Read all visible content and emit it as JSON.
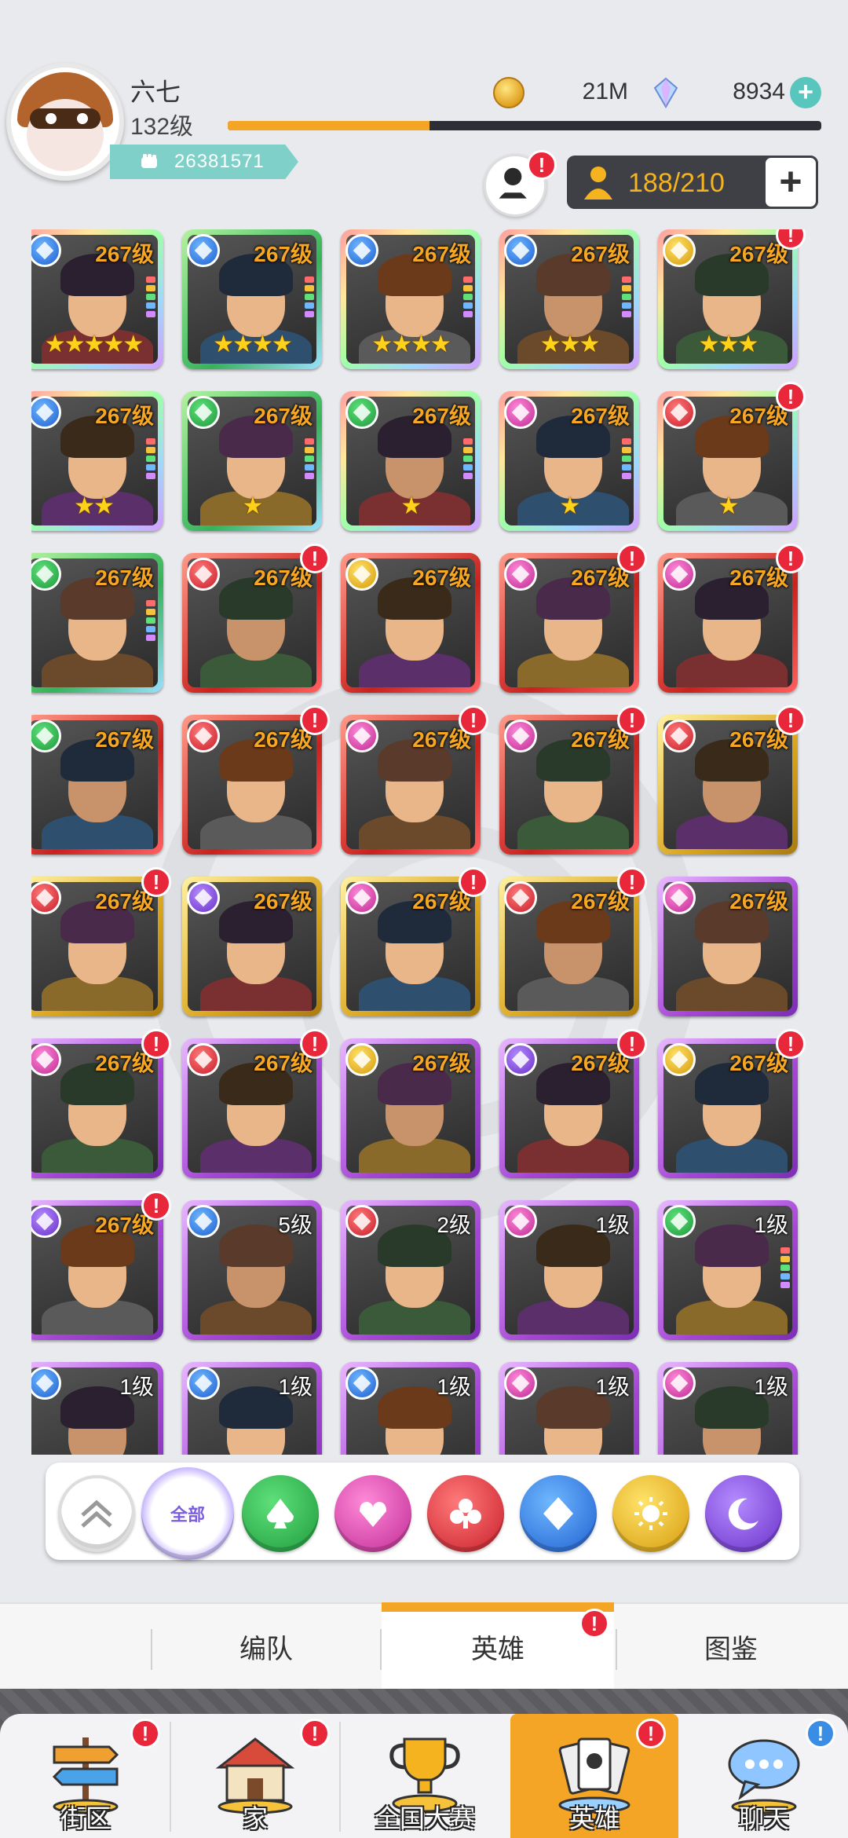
{
  "player": {
    "name": "六七",
    "level": "132级",
    "power": "26381571"
  },
  "currency": {
    "coins": "21M",
    "gems": "8934"
  },
  "xp_fraction": 0.34,
  "capacity": {
    "text": "188/210"
  },
  "colors": {
    "accent": "#f4a526",
    "badge": "#e8273b",
    "teal": "#59c6be"
  },
  "heroes": [
    {
      "lv": "267级",
      "frame": "rainbow",
      "el": "blue",
      "stars": "★★★★★",
      "bars": true,
      "badge": false
    },
    {
      "lv": "267级",
      "frame": "green",
      "el": "blue",
      "stars": "★★★★",
      "bars": true,
      "badge": false
    },
    {
      "lv": "267级",
      "frame": "rainbow",
      "el": "blue",
      "stars": "★★★★",
      "bars": true,
      "badge": false
    },
    {
      "lv": "267级",
      "frame": "rainbow",
      "el": "blue",
      "stars": "★★★",
      "bars": true,
      "badge": false
    },
    {
      "lv": "267级",
      "frame": "rainbow",
      "el": "gold",
      "stars": "★★★",
      "bars": false,
      "badge": true
    },
    {
      "lv": "267级",
      "frame": "rainbow",
      "el": "blue",
      "stars": "★★",
      "bars": true,
      "badge": false
    },
    {
      "lv": "267级",
      "frame": "green",
      "el": "green",
      "stars": "★",
      "bars": true,
      "badge": false
    },
    {
      "lv": "267级",
      "frame": "rainbow",
      "el": "green",
      "stars": "★",
      "bars": true,
      "badge": false
    },
    {
      "lv": "267级",
      "frame": "rainbow",
      "el": "pink",
      "stars": "★",
      "bars": true,
      "badge": false
    },
    {
      "lv": "267级",
      "frame": "rainbow",
      "el": "red",
      "stars": "★",
      "bars": false,
      "badge": true
    },
    {
      "lv": "267级",
      "frame": "green",
      "el": "green",
      "stars": "",
      "bars": true,
      "badge": false
    },
    {
      "lv": "267级",
      "frame": "red",
      "el": "red",
      "stars": "",
      "bars": false,
      "badge": true
    },
    {
      "lv": "267级",
      "frame": "red",
      "el": "gold",
      "stars": "",
      "bars": false,
      "badge": false
    },
    {
      "lv": "267级",
      "frame": "red",
      "el": "pink",
      "stars": "",
      "bars": false,
      "badge": true
    },
    {
      "lv": "267级",
      "frame": "red",
      "el": "pink",
      "stars": "",
      "bars": false,
      "badge": true
    },
    {
      "lv": "267级",
      "frame": "red",
      "el": "green",
      "stars": "",
      "bars": false,
      "badge": false
    },
    {
      "lv": "267级",
      "frame": "red",
      "el": "red",
      "stars": "",
      "bars": false,
      "badge": true
    },
    {
      "lv": "267级",
      "frame": "red",
      "el": "pink",
      "stars": "",
      "bars": false,
      "badge": true
    },
    {
      "lv": "267级",
      "frame": "red",
      "el": "pink",
      "stars": "",
      "bars": false,
      "badge": true
    },
    {
      "lv": "267级",
      "frame": "gold",
      "el": "red",
      "stars": "",
      "bars": false,
      "badge": true
    },
    {
      "lv": "267级",
      "frame": "gold",
      "el": "red",
      "stars": "",
      "bars": false,
      "badge": true
    },
    {
      "lv": "267级",
      "frame": "gold",
      "el": "purple",
      "stars": "",
      "bars": false,
      "badge": false
    },
    {
      "lv": "267级",
      "frame": "gold",
      "el": "pink",
      "stars": "",
      "bars": false,
      "badge": true
    },
    {
      "lv": "267级",
      "frame": "gold",
      "el": "red",
      "stars": "",
      "bars": false,
      "badge": true
    },
    {
      "lv": "267级",
      "frame": "purple",
      "el": "pink",
      "stars": "",
      "bars": false,
      "badge": false
    },
    {
      "lv": "267级",
      "frame": "purple",
      "el": "pink",
      "stars": "",
      "bars": false,
      "badge": true
    },
    {
      "lv": "267级",
      "frame": "purple",
      "el": "red",
      "stars": "",
      "bars": false,
      "badge": true
    },
    {
      "lv": "267级",
      "frame": "purple",
      "el": "gold",
      "stars": "",
      "bars": false,
      "badge": false
    },
    {
      "lv": "267级",
      "frame": "purple",
      "el": "purple",
      "stars": "",
      "bars": false,
      "badge": true
    },
    {
      "lv": "267级",
      "frame": "purple",
      "el": "gold",
      "stars": "",
      "bars": false,
      "badge": true
    },
    {
      "lv": "267级",
      "frame": "purple",
      "el": "purple",
      "stars": "",
      "bars": false,
      "badge": true
    },
    {
      "lv": "5级",
      "frame": "purple",
      "el": "blue",
      "stars": "",
      "bars": false,
      "badge": false
    },
    {
      "lv": "2级",
      "frame": "purple",
      "el": "red",
      "stars": "",
      "bars": false,
      "badge": false
    },
    {
      "lv": "1级",
      "frame": "purple",
      "el": "pink",
      "stars": "",
      "bars": false,
      "badge": false
    },
    {
      "lv": "1级",
      "frame": "purple",
      "el": "green",
      "stars": "",
      "bars": true,
      "badge": false
    },
    {
      "lv": "1级",
      "frame": "purple",
      "el": "blue",
      "stars": "",
      "bars": false,
      "badge": false
    },
    {
      "lv": "1级",
      "frame": "purple",
      "el": "blue",
      "stars": "",
      "bars": false,
      "badge": false
    },
    {
      "lv": "1级",
      "frame": "purple",
      "el": "blue",
      "stars": "",
      "bars": false,
      "badge": false
    },
    {
      "lv": "1级",
      "frame": "purple",
      "el": "pink",
      "stars": "",
      "bars": false,
      "badge": false
    },
    {
      "lv": "1级",
      "frame": "purple",
      "el": "pink",
      "stars": "",
      "bars": false,
      "badge": false
    }
  ],
  "filters": {
    "all_label": "全部",
    "items": [
      "chevron-up",
      "all",
      "green-spade",
      "pink-heart",
      "red-club",
      "blue-diamond",
      "gold-sun",
      "purple-moon"
    ]
  },
  "subtabs": [
    {
      "label": "编队",
      "active": false,
      "badge": false
    },
    {
      "label": "英雄",
      "active": true,
      "badge": true
    },
    {
      "label": "图鉴",
      "active": false,
      "badge": false
    }
  ],
  "nav": [
    {
      "label": "街区",
      "icon": "signpost-icon",
      "badge": "red",
      "active": false
    },
    {
      "label": "家",
      "icon": "house-icon",
      "badge": "red",
      "active": false
    },
    {
      "label": "全国大赛",
      "icon": "trophy-icon",
      "badge": "",
      "active": false
    },
    {
      "label": "英雄",
      "icon": "hero-cards-icon",
      "badge": "red",
      "active": true
    },
    {
      "label": "聊天",
      "icon": "chat-bubble-icon",
      "badge": "blue",
      "active": false
    }
  ]
}
